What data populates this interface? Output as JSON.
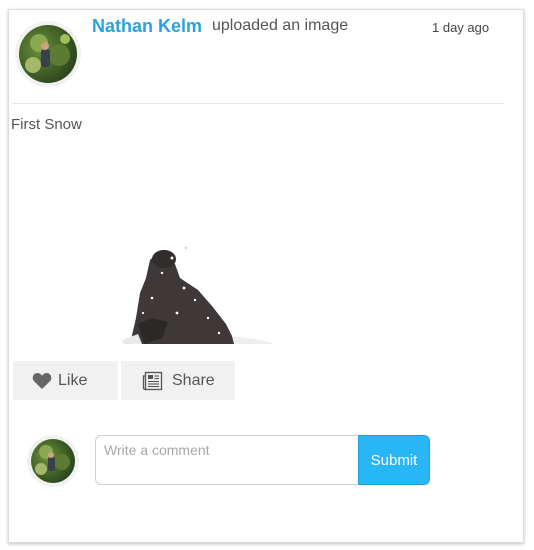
{
  "post": {
    "author": "Nathan Kelm",
    "action": "uploaded an image",
    "timestamp": "1 day ago",
    "caption": "First Snow"
  },
  "actions": {
    "like_label": "Like",
    "share_label": "Share"
  },
  "comment": {
    "placeholder": "Write a comment",
    "value": "",
    "submit_label": "Submit"
  },
  "colors": {
    "link": "#2aa3dc",
    "submit_bg": "#29b6f6",
    "button_bg": "#f1f1f1"
  }
}
